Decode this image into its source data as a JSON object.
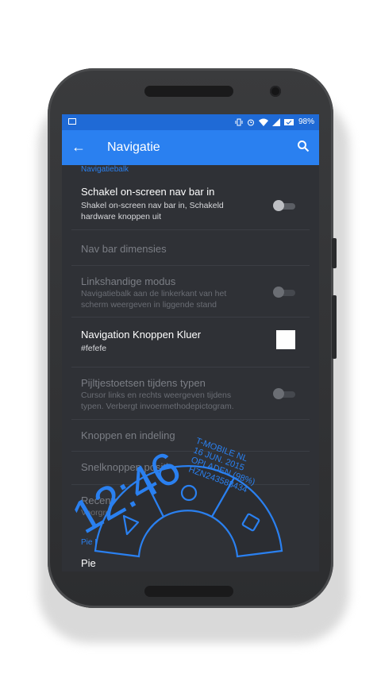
{
  "status_bar": {
    "battery": "98%",
    "icons": [
      "image-icon",
      "vibrate-icon",
      "alarm-icon",
      "wifi-icon",
      "signal-icon",
      "battery-icon"
    ]
  },
  "app_bar": {
    "title": "Navigatie",
    "back_icon": "arrow-back-icon",
    "search_icon": "search-icon"
  },
  "settings": {
    "category_nav": "Navigatiebalk",
    "items": [
      {
        "title": "Schakel on-screen nav bar in",
        "summary": "Shakel on-screen nav bar in, Schakeld hardware knoppen uit",
        "enabled": true,
        "switch": "off"
      },
      {
        "title": "Nav bar dimensies",
        "summary": "",
        "enabled": false
      },
      {
        "title": "Linkshandige modus",
        "summary": "Navigatiebalk aan de linkerkant van het scherm weergeven in liggende stand",
        "enabled": false,
        "switch": "off"
      },
      {
        "title": "Navigation Knoppen Kluer",
        "summary": "#fefefe",
        "enabled": true,
        "color": "#fefefe"
      },
      {
        "title": "Pijltjestoetsen tijdens typen",
        "summary": "Cursor links en rechts weergeven tijdens typen. Verbergt invoermethodepictogram.",
        "enabled": false,
        "switch": "off"
      },
      {
        "title": "Knoppen en indeling",
        "summary": "",
        "enabled": false
      },
      {
        "title": "Snelknoppen positie",
        "summary": "",
        "enabled": false
      },
      {
        "title": "Recente apps-knop lang indrukken",
        "summary": "Voorgrond",
        "enabled": false
      }
    ],
    "category_pie": "Pie Navigatie",
    "pie_item": "Pie"
  },
  "pie_control": {
    "time": "12:46",
    "info_lines": [
      "T-MOBILE NL",
      "16 JUN. 2015",
      "OPLADEN (98%)",
      "HZN243588434"
    ],
    "buttons": [
      "back-triangle-icon",
      "home-circle-icon",
      "recents-square-icon"
    ],
    "accent": "#2a80f0"
  }
}
